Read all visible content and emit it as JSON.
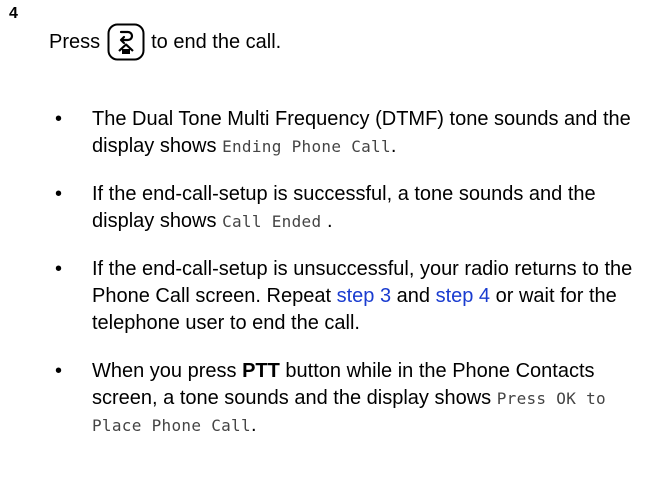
{
  "step": {
    "number": "4",
    "press_prefix": "Press",
    "press_suffix": "to end the call.",
    "key_icon": "back-home-key-icon"
  },
  "bullets": [
    {
      "parts": [
        {
          "text": "The Dual Tone Multi Frequency (DTMF) tone sounds and the display shows ",
          "style": "normal"
        },
        {
          "text": "Ending Phone Call",
          "style": "mono"
        },
        {
          "text": ".",
          "style": "normal"
        }
      ]
    },
    {
      "parts": [
        {
          "text": "If the end-call-setup is successful, a tone sounds and the display shows ",
          "style": "normal"
        },
        {
          "text": "Call Ended",
          "style": "mono"
        },
        {
          "text": " .",
          "style": "normal"
        }
      ]
    },
    {
      "parts": [
        {
          "text": "If the end-call-setup is unsuccessful, your radio returns to the Phone Call screen. Repeat ",
          "style": "normal"
        },
        {
          "text": "step 3",
          "style": "link"
        },
        {
          "text": " and ",
          "style": "normal"
        },
        {
          "text": "step 4",
          "style": "link"
        },
        {
          "text": " or wait for the telephone user to end the call.",
          "style": "normal"
        }
      ]
    },
    {
      "parts": [
        {
          "text": "When you press ",
          "style": "normal"
        },
        {
          "text": "PTT",
          "style": "bold"
        },
        {
          "text": " button while in the Phone Contacts screen, a tone sounds and the display shows ",
          "style": "normal"
        },
        {
          "text": "Press OK to Place Phone Call",
          "style": "mono"
        },
        {
          "text": ".",
          "style": "normal"
        }
      ]
    }
  ],
  "bullet_glyph": "•",
  "colors": {
    "text": "#000000",
    "link": "#1a3cd0",
    "display_text": "#444444"
  }
}
